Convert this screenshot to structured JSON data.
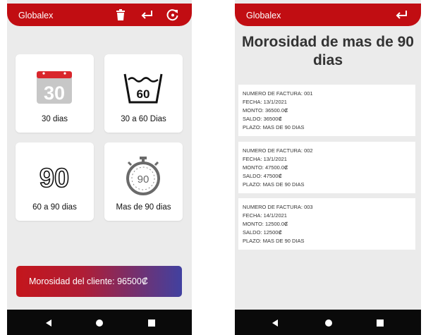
{
  "left_screen": {
    "appbar": {
      "title": "Globalex",
      "icons": [
        "trash-icon",
        "return-icon",
        "refresh-icon"
      ]
    },
    "tiles": [
      {
        "label": "30 dias",
        "icon": "calendar-30-icon",
        "icon_text": "30"
      },
      {
        "label": "30 a 60 Dias",
        "icon": "wash-60-icon",
        "icon_text": "60"
      },
      {
        "label": "60 a 90 dias",
        "icon": "outline-90-icon",
        "icon_text": "90"
      },
      {
        "label": "Mas de 90 dias",
        "icon": "stopwatch-90-icon",
        "icon_text": "90"
      }
    ],
    "banner": {
      "text": "Morosidad del cliente: 96500₡"
    }
  },
  "right_screen": {
    "appbar": {
      "title": "Globalex",
      "icons": [
        "return-icon"
      ]
    },
    "page_title": "Morosidad de mas de 90 dias",
    "invoices": [
      {
        "numero": "NUMERO DE FACTURA: 001",
        "fecha": "FECHA: 13/1/2021",
        "monto": "MONTO: 36500.0₡",
        "saldo": "SALDO: 36500₡",
        "plazo": "PLAZO: MAS DE 90 DIAS"
      },
      {
        "numero": "NUMERO DE FACTURA: 002",
        "fecha": "FECHA: 13/1/2021",
        "monto": "MONTO: 47500.0₡",
        "saldo": "SALDO: 47500₡",
        "plazo": "PLAZO: MAS DE 90 DIAS"
      },
      {
        "numero": "NUMERO DE FACTURA: 003",
        "fecha": "FECHA: 14/1/2021",
        "monto": "MONTO: 12500.0₡",
        "saldo": "SALDO: 12500₡",
        "plazo": "PLAZO: MAS DE 90 DIAS"
      }
    ]
  },
  "navbar": {
    "icons": [
      "back-icon",
      "home-icon",
      "recents-icon"
    ]
  },
  "colors": {
    "appbar": "#c10d12",
    "banner_start": "#c4161c",
    "banner_end": "#4141a0",
    "background": "#ebebeb"
  }
}
